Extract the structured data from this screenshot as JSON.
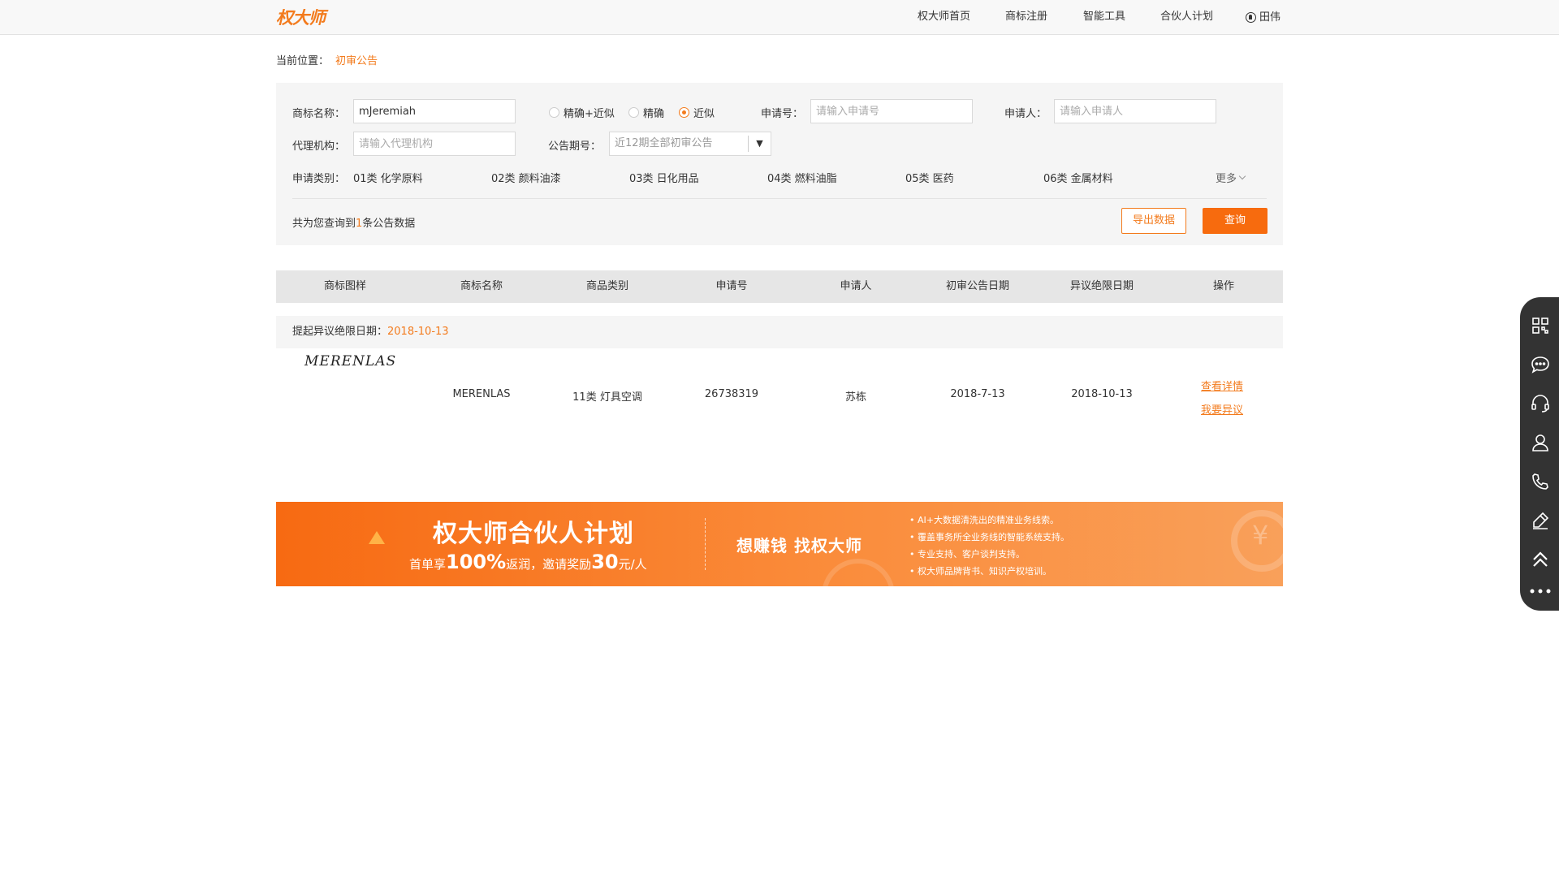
{
  "header": {
    "logo_text": "权大师",
    "nav": [
      "权大师首页",
      "商标注册",
      "智能工具",
      "合伙人计划"
    ],
    "user_name": "田伟"
  },
  "breadcrumb": {
    "label": "当前位置：",
    "current": "初审公告"
  },
  "search": {
    "tm_name_label": "商标名称：",
    "tm_name_value": "mJeremiah",
    "match_modes": [
      "精确+近似",
      "精确",
      "近似"
    ],
    "match_selected": "近似",
    "app_no_label": "申请号：",
    "app_no_placeholder": "请输入申请号",
    "applicant_label": "申请人：",
    "applicant_placeholder": "请输入申请人",
    "agency_label": "代理机构：",
    "agency_placeholder": "请输入代理机构",
    "issue_label": "公告期号：",
    "issue_value": "近12期全部初审公告",
    "category_label": "申请类别：",
    "categories": [
      "01类 化学原料",
      "02类 颜料油漆",
      "03类 日化用品",
      "04类 燃料油脂",
      "05类 医药",
      "06类 金属材料"
    ],
    "more_label": "更多",
    "count_prefix": "共为您查询到",
    "count_value": "1",
    "count_suffix": "条公告数据",
    "export_label": "导出数据",
    "query_label": "查询"
  },
  "table": {
    "headers": [
      "商标图样",
      "商标名称",
      "商品类别",
      "申请号",
      "申请人",
      "初审公告日期",
      "异议绝限日期",
      "操作"
    ],
    "group_label": "提起异议绝限日期：",
    "group_date": "2018-10-13",
    "rows": [
      {
        "image_text": "MERENLAS",
        "name": "MERENLAS",
        "category": "11类 灯具空调",
        "app_no": "26738319",
        "applicant": "苏栋",
        "prelim_date": "2018-7-13",
        "deadline": "2018-10-13",
        "action_detail": "查看详情",
        "action_oppose": "我要异议"
      }
    ]
  },
  "banner": {
    "title": "权大师合伙人计划",
    "sub_prefix": "首单享",
    "sub_pct": "100%",
    "sub_mid": "返润，邀请奖励",
    "sub_amount": "30",
    "sub_suffix": "元/人",
    "slogan": "想赚钱  找权大师",
    "points": [
      "AI+大数据清洗出的精准业务线索。",
      "覆盖事务所全业务线的智能系统支持。",
      "专业支持、客户谈判支持。",
      "权大师品牌背书、知识产权培训。"
    ],
    "coin_glyph": "¥"
  },
  "sidebar": {
    "icons": [
      "qrcode-icon",
      "chat-icon",
      "headset-icon",
      "user-icon",
      "phone-icon",
      "edit-icon",
      "back-to-top-icon",
      "more-icon"
    ]
  },
  "colors": {
    "accent": "#f37b1d",
    "button": "#f76b0e",
    "sidebar": "#333333"
  }
}
